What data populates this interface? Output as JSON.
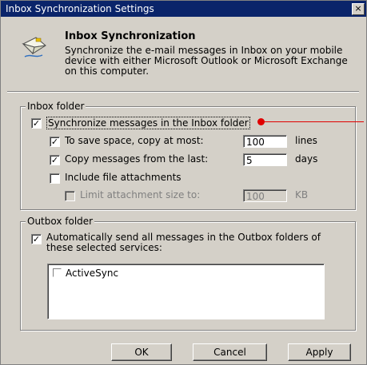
{
  "window": {
    "title": "Inbox Synchronization Settings",
    "close_glyph": "×"
  },
  "header": {
    "icon": "mail-envelope-icon",
    "title": "Inbox Synchronization",
    "description": "Synchronize the e-mail messages in Inbox on your mobile device with either Microsoft Outlook or Microsoft Exchange on this computer."
  },
  "inbox": {
    "legend": "Inbox folder",
    "sync_label": "Synchronize messages in the Inbox folder",
    "sync_checked": true,
    "copy_at_most_label": "To save space, copy at most:",
    "copy_at_most_checked": true,
    "copy_at_most_value": "100",
    "copy_at_most_unit": "lines",
    "copy_last_label": "Copy messages from the last:",
    "copy_last_checked": true,
    "copy_last_value": "5",
    "copy_last_unit": "days",
    "include_attachments_label": "Include file attachments",
    "include_attachments_checked": false,
    "limit_size_label": "Limit attachment size to:",
    "limit_size_checked": false,
    "limit_size_value": "100",
    "limit_size_unit": "KB"
  },
  "outbox": {
    "legend": "Outbox folder",
    "auto_send_label": "Automatically send all messages in the Outbox folders of these selected services:",
    "auto_send_checked": true,
    "services": [
      {
        "label": "ActiveSync",
        "checked": false
      }
    ]
  },
  "buttons": {
    "ok": "OK",
    "cancel": "Cancel",
    "apply": "Apply"
  },
  "colors": {
    "titlebar": "#0a246a",
    "face": "#d4d0c8",
    "annotation": "#e00000"
  }
}
